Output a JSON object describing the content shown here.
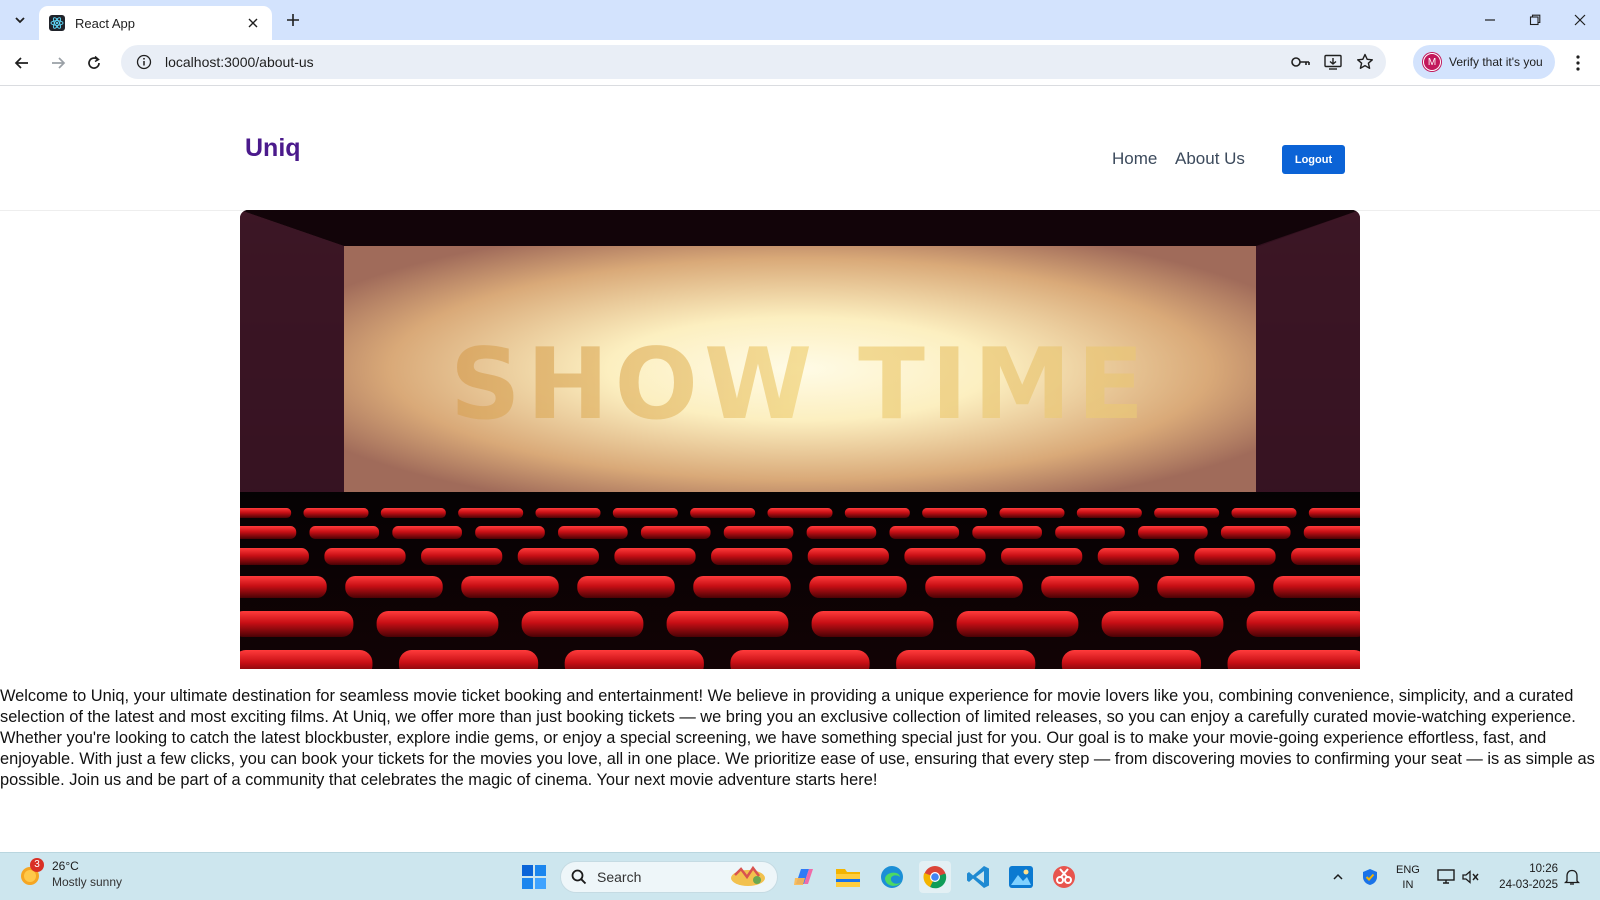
{
  "browser": {
    "tab_title": "React App",
    "url": "localhost:3000/about-us",
    "profile_label": "Verify that it's you",
    "profile_initial": "M"
  },
  "site": {
    "brand": "Uniq",
    "nav": {
      "home": "Home",
      "about": "About Us"
    },
    "logout_label": "Logout",
    "hero_text": "SHOW TIME",
    "about_paragraph": "Welcome to Uniq, your ultimate destination for seamless movie ticket booking and entertainment! We believe in providing a unique experience for movie lovers like you, combining convenience, simplicity, and a curated selection of the latest and most exciting films. At Uniq, we offer more than just booking tickets — we bring you an exclusive collection of limited releases, so you can enjoy a carefully curated movie-watching experience. Whether you're looking to catch the latest blockbuster, explore indie gems, or enjoy a special screening, we have something special just for you. Our goal is to make your movie-going experience effortless, fast, and enjoyable. With just a few clicks, you can book your tickets for the movies you love, all in one place. We prioritize ease of use, ensuring that every step — from discovering movies to confirming your seat — is as simple as possible. Join us and be part of a community that celebrates the magic of cinema. Your next movie adventure starts here!"
  },
  "taskbar": {
    "weather_badge": "3",
    "weather_temp": "26°C",
    "weather_condition": "Mostly sunny",
    "search_label": "Search",
    "lang_top": "ENG",
    "lang_bottom": "IN",
    "time": "10:26",
    "date": "24-03-2025"
  },
  "colors": {
    "brand": "#4b1a8c",
    "logout_bg": "#0b63d6",
    "tabstrip_bg": "#d3e3fd",
    "taskbar_bg": "#cde6ee"
  }
}
